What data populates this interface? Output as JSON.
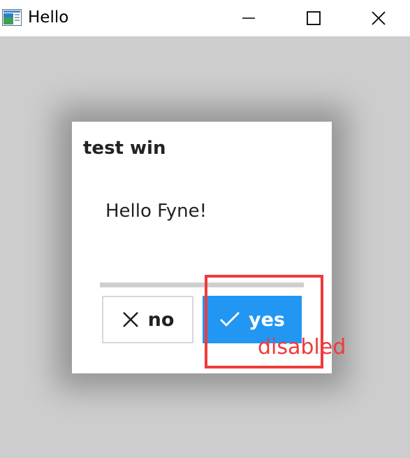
{
  "window": {
    "title": "Hello",
    "background_color": "#cdcdcd",
    "controls": {
      "minimize_icon": "minimize-icon",
      "maximize_icon": "maximize-icon",
      "close_icon": "close-icon"
    }
  },
  "dialog": {
    "title": "test win",
    "message": "Hello Fyne!",
    "buttons": {
      "no": {
        "label": "no",
        "icon": "close-icon"
      },
      "yes": {
        "label": "yes",
        "icon": "check-icon",
        "color": "#2196f3"
      }
    }
  },
  "annotation": {
    "text": "disabled",
    "color": "#f03a3a"
  }
}
